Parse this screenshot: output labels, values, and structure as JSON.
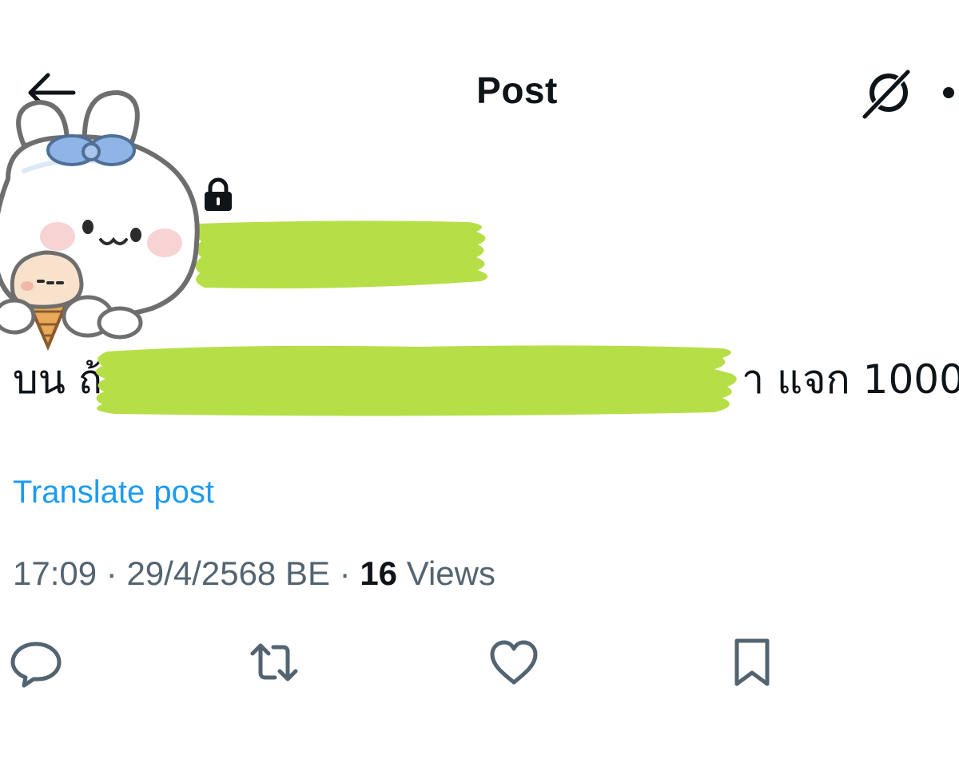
{
  "header": {
    "title": "Post",
    "back_icon": "arrow-left-icon",
    "grok_icon": "grok-icon",
    "more_icon": "more-icon"
  },
  "author": {
    "avatar": "avatar-bunny-sticker",
    "protected_icon": "lock-icon",
    "name_redacted": true
  },
  "post": {
    "text_start": "บน ถ้",
    "text_end": "า แจก 1000",
    "redaction_color": "#b6df47"
  },
  "translate_label": "Translate post",
  "meta": {
    "time": "17:09",
    "sep1": " · ",
    "date": "29/4/2568 BE",
    "sep2": " · ",
    "views_count": "16",
    "views_label": " Views"
  },
  "actions": {
    "reply_icon": "reply-icon",
    "repost_icon": "repost-icon",
    "like_icon": "like-icon",
    "bookmark_icon": "bookmark-icon"
  },
  "colors": {
    "text": "#0f1419",
    "secondary": "#536471",
    "link": "#1d9bf0",
    "redaction": "#b6df47"
  }
}
